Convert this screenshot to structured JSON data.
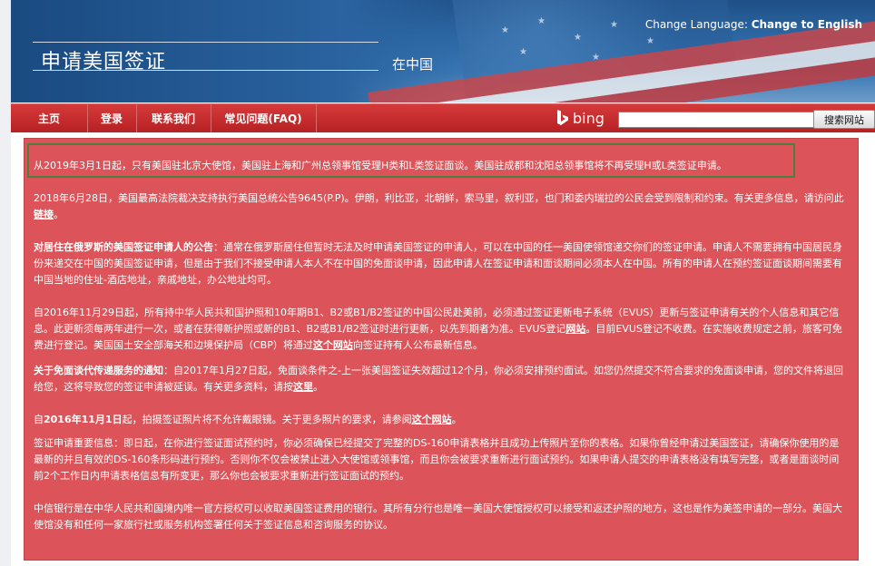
{
  "header": {
    "title": "申请美国签证",
    "subtitle": "在中国",
    "change_language_label": "Change Language:",
    "change_language_link": "Change to English"
  },
  "nav": {
    "items": [
      {
        "label": "主页"
      },
      {
        "label": "登录"
      },
      {
        "label": "联系我们"
      },
      {
        "label": "常见问题(FAQ)"
      }
    ],
    "bing_label": "bing",
    "search_button": "搜索网站",
    "search_value": ""
  },
  "content": {
    "notice_2019": "从2019年3月1日起，只有美国驻北京大使馆，美国驻上海和广州总领事馆受理H类和L类签证面谈。美国驻成都和沈阳总领事馆将不再受理H或L类签证申请。",
    "p_2018": {
      "text": "2018年6月28日，美国最高法院裁决支持执行美国总统公告9645(P.P)。伊朗，利比亚，北朝鲜，索马里，叙利亚，也门和委内瑞拉的公民会受到限制和约束。有关更多信息，请访问此",
      "link": "链接",
      "end": "。"
    },
    "p_russia": {
      "bold": "对居住在俄罗斯的美国签证申请人的公告",
      "text": "：通常在俄罗斯居住但暂时无法及时申请美国签证的申请人，可以在中国的任一美国使领馆递交你们的签证申请。申请人不需要拥有中国居民身份来递交在中国的美国签证申请，但是由于我们不接受申请人本人不在中国的免面谈申请，因此申请人在签证申请和面谈期间必须本人在中国。所有的申请人在预约签证面谈期间需要有中国当地的住址-酒店地址，亲戚地址，办公地址均可。"
    },
    "p_evus": {
      "text1": "自2016年11月29日起，所有持中华人民共和国护照和10年期B1、B2或B1/B2签证的中国公民赴美前，必须通过签证更新电子系统（EVUS）更新与签证申请有关的个人信息和其它信息。此更新须每两年进行一次，或者在获得新护照或新的B1、B2或B1/B2签证时进行更新，以先到期者为准。EVUS登记",
      "link1": "网站",
      "text2": "。目前EVUS登记不收费。在实施收费规定之前，旅客可免费进行登记。美国国土安全部海关和边境保护局（CBP）将通过",
      "link2": "这个网站",
      "text3": "向签证持有人公布最新信息。"
    },
    "p_dropbox": {
      "bold": "关于免面谈代传递服务的通知",
      "text": "：自2017年1月27日起，免面谈条件之-上一张美国签证失效超过12个月，你必须安排预约面试。如您仍然提交不符合要求的免面谈申请，您的文件将退回给您，这将导致您的签证申请被延误。有关更多资料，请按",
      "link": "这里",
      "end": "。"
    },
    "p_glasses": {
      "text1": "自",
      "bold": "2016年11月1日",
      "text2": "起，拍摄签证照片将不允许戴眼镜。关于更多照片的要求，请参阅",
      "link": "这个网站",
      "end": "。"
    },
    "p_ds160": "签证申请重要信息：即日起，在你进行签证面试预约时，你必须确保已经提交了完整的DS-160申请表格并且成功上传照片至你的表格。如果你曾经申请过美国签证，请确保你使用的是最新的并且有效的DS-160条形码进行预约。否则你不仅会被禁止进入大使馆或领事馆，而且你会被要求重新进行面试预约。如果申请人提交的申请表格没有填写完整，或者是面谈时间前2个工作日内申请表格信息有所变更，那么你也会被要求重新进行签证面试的预约。",
    "p_citic": "中信银行是在中华人民共和国境内唯一官方授权可以收取美国签证费用的银行。其所有分行也是唯一美国大使馆授权可以接受和返还护照的地方，这也是作为美签申请的一部分。美国大使馆没有和任何一家旅行社或服务机构签署任何关于签证信息和咨询服务的协议。"
  },
  "colors": {
    "nav_red": "#c22a2d",
    "content_red": "#dc5459",
    "notice_border": "#4f7d3d",
    "header_blue": "#2c67a3"
  }
}
